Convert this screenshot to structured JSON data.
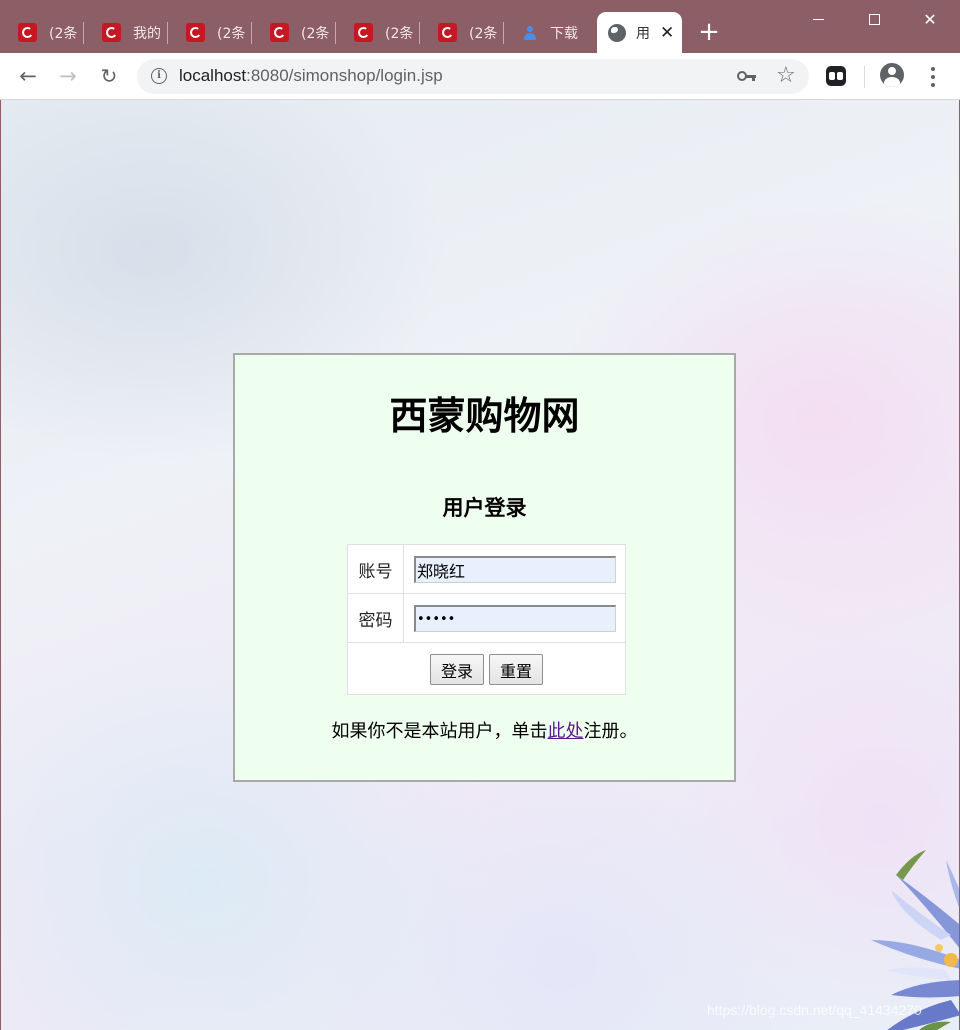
{
  "browser": {
    "tabs": [
      {
        "title": "(2条",
        "icon": "csdn-icon"
      },
      {
        "title": "我的",
        "icon": "csdn-icon"
      },
      {
        "title": "(2条",
        "icon": "csdn-icon"
      },
      {
        "title": "(2条",
        "icon": "csdn-icon"
      },
      {
        "title": "(2条",
        "icon": "csdn-icon"
      },
      {
        "title": "(2条",
        "icon": "csdn-icon"
      },
      {
        "title": "下载",
        "icon": "user-icon"
      }
    ],
    "active_tab": {
      "title": "用",
      "icon": "globe-icon"
    },
    "url_host": "localhost",
    "url_rest": ":8080/simonshop/login.jsp",
    "accent_color": "#8c5e66"
  },
  "page": {
    "site_title": "西蒙购物网",
    "login_title": "用户登录",
    "form": {
      "username_label": "账号",
      "username_value": "郑晓红",
      "password_label": "密码",
      "password_value": "•••••",
      "login_button": "登录",
      "reset_button": "重置"
    },
    "register": {
      "prefix": "如果你不是本站用户，单击",
      "link": "此处",
      "suffix": "注册。"
    },
    "panel_color": "#efffef"
  },
  "watermark": "https://blog.csdn.net/qq_41434270"
}
